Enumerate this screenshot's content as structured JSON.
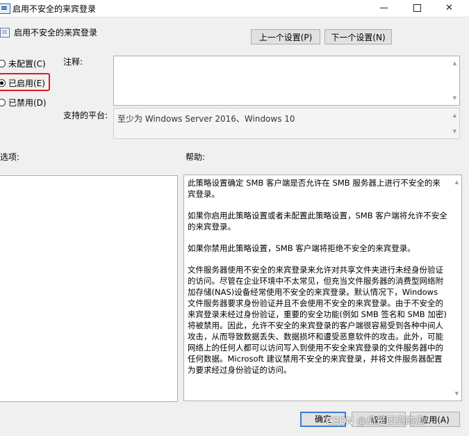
{
  "window": {
    "title": "启用不安全的来宾登录",
    "controls": {
      "minimize": "—",
      "close": "✕"
    }
  },
  "header": {
    "policy_name": "启用不安全的来宾登录",
    "prev_button": "上一个设置(P)",
    "next_button": "下一个设置(N)"
  },
  "state": {
    "options": [
      {
        "label": "未配置(C)",
        "selected": false
      },
      {
        "label": "已启用(E)",
        "selected": true
      },
      {
        "label": "已禁用(D)",
        "selected": false
      }
    ],
    "highlight_color": "#e21b23"
  },
  "comment": {
    "label": "注释:",
    "value": ""
  },
  "platform": {
    "label": "支持的平台:",
    "value": "至少为 Windows Server 2016、Windows 10"
  },
  "options_panel": {
    "label": "选项:"
  },
  "help": {
    "label": "帮助:",
    "paragraphs": [
      "此策略设置确定 SMB 客户端是否允许在 SMB 服务器上进行不安全的来宾登录。",
      "如果你启用此策略设置或者未配置此策略设置，SMB 客户端将允许不安全的来宾登录。",
      "如果你禁用此策略设置，SMB 客户端将拒绝不安全的来宾登录。",
      "文件服务器使用不安全的来宾登录来允许对共享文件夹进行未经身份验证的访问。尽管在企业环境中不太常见，但充当文件服务器的消费型网络附加存储(NAS)设备经常使用不安全的来宾登录。默认情况下，Windows 文件服务器要求身份验证并且不会使用不安全的来宾登录。由于不安全的来宾登录未经过身份验证，重要的安全功能(例如 SMB 签名和 SMB 加密)将被禁用。因此，允许不安全的来宾登录的客户端很容易受到各种中间人攻击，从而导致数据丢失、数据损坏和遭受恶意软件的攻击。此外，可能网络上的任何人都可以访问写入到使用不安全来宾登录的文件服务器中的任何数据。Microsoft 建议禁用不安全的来宾登录，并将文件服务器配置为要求经过身份验证的访问。"
    ]
  },
  "footer": {
    "ok_button": "确定",
    "cancel_button": "取消",
    "apply_button": "应用(A)"
  },
  "watermark": "CSDN @瓜是西瓜的瓜"
}
